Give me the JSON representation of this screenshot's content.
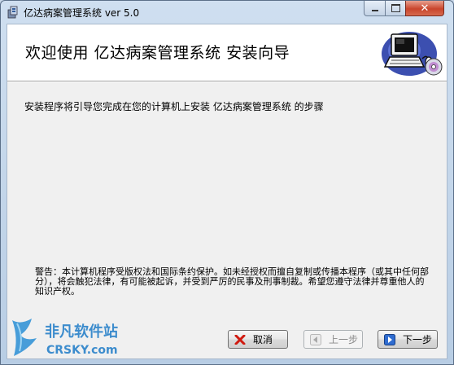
{
  "window": {
    "title": "亿达病案管理系统 ver 5.0",
    "controls": {
      "minimize": "minimize",
      "maximize": "maximize",
      "close": "close"
    }
  },
  "header": {
    "heading": "欢迎使用  亿达病案管理系统  安装向导",
    "logo_icon": "computer-cd-icon"
  },
  "body": {
    "intro": "安装程序将引导您完成在您的计算机上安装 亿达病案管理系统 的步骤",
    "warning": "警告：本计算机程序受版权法和国际条约保护。如未经授权而擅自复制或传播本程序（或其中任何部分），将会触犯法律，有可能被起诉，并受到严厉的民事及刑事制裁。希望您遵守法律并尊重他人的知识产权。"
  },
  "buttons": {
    "cancel": "取消",
    "back": "上一步",
    "next": "下一步"
  },
  "watermark": {
    "line1": "非凡软件站",
    "line2": "CRSKY.com"
  },
  "colors": {
    "close_button": "#c9452c",
    "cancel_icon": "#d01a10",
    "next_icon": "#1f58b8"
  }
}
